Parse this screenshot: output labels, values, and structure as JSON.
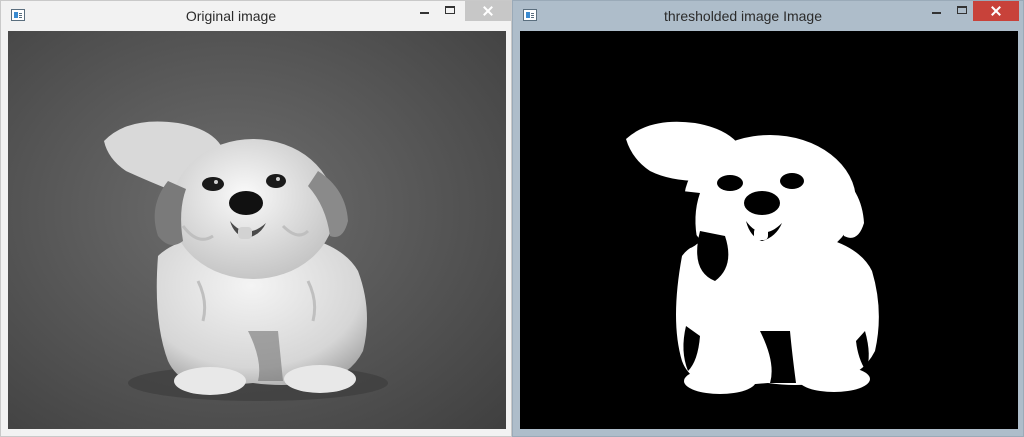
{
  "windows": [
    {
      "title": "Original image",
      "state": "inactive",
      "icon": "app-window-icon",
      "controls": [
        "minimize-icon",
        "maximize-icon",
        "close-icon"
      ],
      "content": "grayscale photo of a small fluffy dog"
    },
    {
      "title": "thresholded image Image",
      "state": "active",
      "icon": "app-window-icon",
      "controls": [
        "minimize-icon",
        "maximize-icon",
        "close-icon"
      ],
      "content": "binary thresholded silhouette of the dog"
    }
  ],
  "colors": {
    "close_active": "#c8423a",
    "close_inactive": "#c7c7c7",
    "active_frame": "#aebdca",
    "threshold_background": "#000000",
    "threshold_foreground": "#ffffff"
  }
}
